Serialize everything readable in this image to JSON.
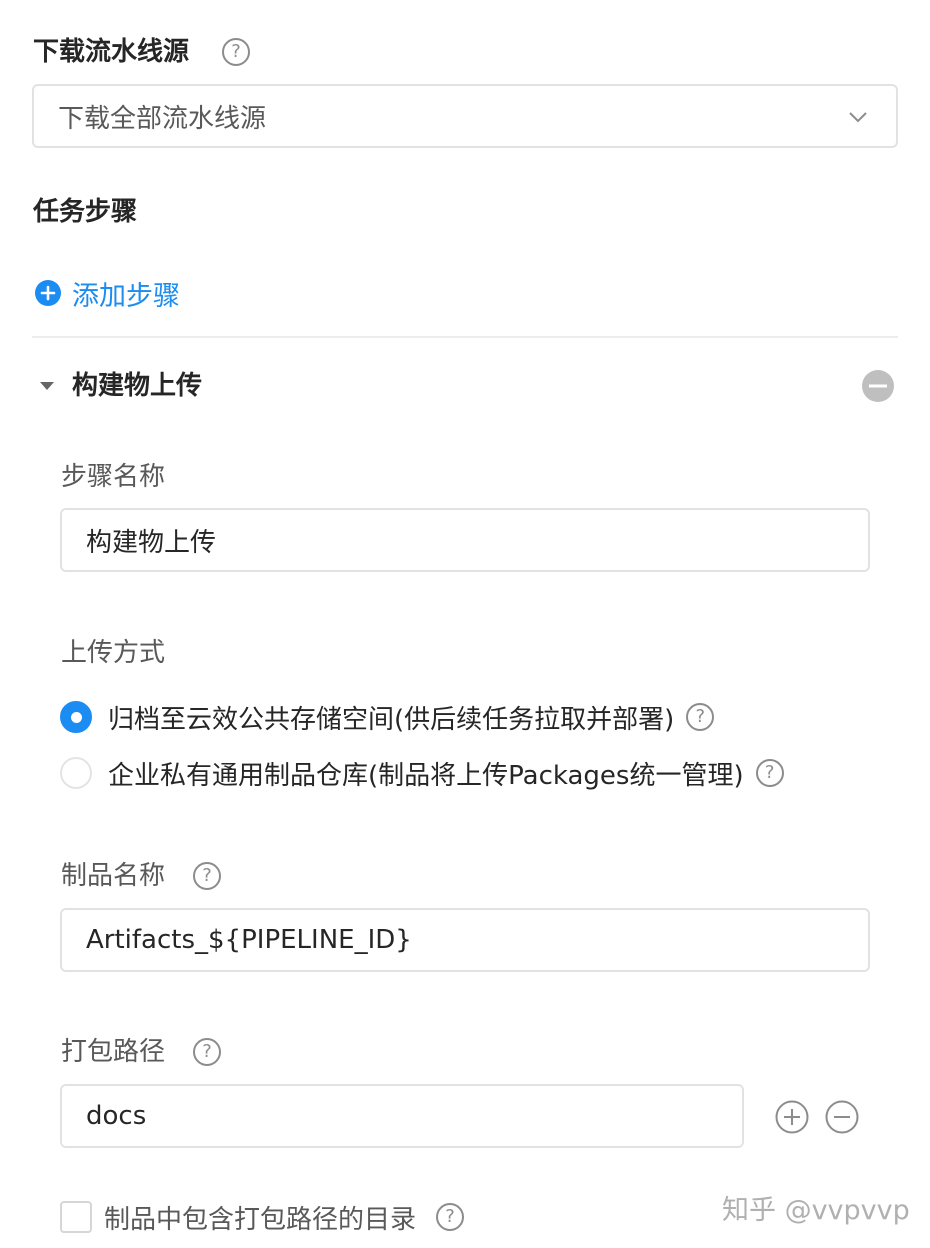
{
  "download_source": {
    "label": "下载流水线源",
    "help_icon": "question-circle-icon",
    "select_value": "下载全部流水线源",
    "chevron_icon": "chevron-down-icon"
  },
  "task_steps": {
    "label": "任务步骤",
    "add_step_label": "添加步骤",
    "add_icon": "plus-circle-icon",
    "accent_color": "#1b8cf2"
  },
  "step": {
    "title": "构建物上传",
    "collapse_icon": "caret-down-icon",
    "remove_icon": "minus-circle-icon",
    "step_name": {
      "label": "步骤名称",
      "value": "构建物上传"
    },
    "upload_method": {
      "label": "上传方式",
      "options": [
        {
          "label": "归档至云效公共存储空间(供后续任务拉取并部署)",
          "selected": true
        },
        {
          "label": "企业私有通用制品仓库(制品将上传Packages统一管理)",
          "selected": false
        }
      ]
    },
    "artifact_name": {
      "label": "制品名称",
      "value": "Artifacts_${PIPELINE_ID}"
    },
    "pack_path": {
      "label": "打包路径",
      "value": "docs",
      "add_icon": "plus-circle-outline-icon",
      "remove_icon": "minus-circle-outline-icon"
    },
    "include_dir": {
      "label": "制品中包含打包路径的目录",
      "checked": false
    }
  },
  "watermark": "知乎 @vvpvvp"
}
